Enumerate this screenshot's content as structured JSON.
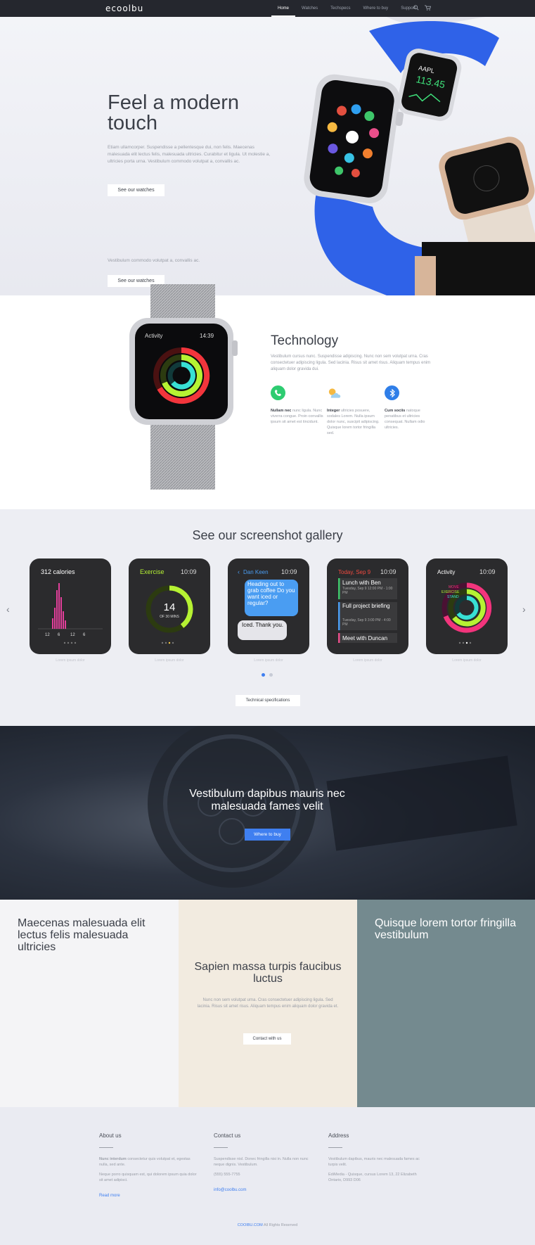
{
  "nav": {
    "logo": "ecoolbu",
    "links": [
      "Home",
      "Watches",
      "Techspecs",
      "Where to buy",
      "Support"
    ],
    "active": "Home",
    "icons": [
      "search-icon",
      "cart-icon"
    ]
  },
  "hero": {
    "title": "Feel a modern touch",
    "body": "Etiam ullamcorper. Suspendisse a pellentesque dui, non felis. Maecenas malesuada elit lectus felis, malesuada ultricies. Curabitur et ligula. Ut molestie a, ultricies porta urna. Vestibulum commodo volutpat a, convallis ac.",
    "button": "See our watches",
    "body2": "Vestibulum commodo volutpat a, convallis ac.",
    "button2": "See our watches",
    "watch_time": "10:09",
    "watch_stock": "AAPL",
    "watch_price": "113.45"
  },
  "tech": {
    "title": "Technology",
    "body": "Vestibulum cursus nunc. Suspendisse adipiscing. Nunc non sem volutpat urna. Cras consectetuer adipiscing ligula. Sed lacinia. Risus sit amet risus. Aliquam tempus enim aliquam dolor gravida dui.",
    "watch_label": "Activity",
    "watch_time": "14:39",
    "features": [
      {
        "bold": "Nullam nec",
        "text": "nunc ligula. Nunc viverra congue. Proin convallis ipsum sit amet est tincidunt.",
        "icon": "phone-icon",
        "color": "#2ecc71"
      },
      {
        "bold": "Integer",
        "text": "ultricies posuere, sodales Lorem. Nulla ipsum dolor nunc, suscipit adipiscing. Quisque lorem tortor fringilla sed.",
        "icon": "weather-icon",
        "color": "#f5b942"
      },
      {
        "bold": "Cum sociis",
        "text": "natoque penatibus et ultricies consequat. Nullam odio ultricies.",
        "icon": "bluetooth-icon",
        "color": "#2f7ee8"
      }
    ]
  },
  "gallery": {
    "title": "See our screenshot gallery",
    "screens": [
      {
        "name": "calories",
        "title": "312 calories",
        "labels": [
          "12",
          "6",
          "12",
          "6"
        ],
        "caption": "Lorem ipsum dolor"
      },
      {
        "name": "exercise",
        "title": "Exercise",
        "time": "10:09",
        "value": "14",
        "unit": "OF 30 MINS",
        "caption": "Lorem ipsum dolor"
      },
      {
        "name": "messages",
        "title": "Dan Keen",
        "time": "10:09",
        "msg1": "Heading out to grab coffee Do you want iced or regular?",
        "msg2": "Iced. Thank you.",
        "caption": "Lorem ipsum dolor"
      },
      {
        "name": "calendar",
        "title": "Today, Sep 9",
        "time": "10:09",
        "ev1": "Lunch with Ben",
        "ev1sub": "Tuesday, Sep 9 12:00 PM - 1:00 PM",
        "ev2": "Full project briefing",
        "ev2sub": "Tuesday, Sep 9 3:00 PM - 4:00 PM",
        "ev3": "Meet with Duncan",
        "caption": "Lorem ipsum dolor"
      },
      {
        "name": "activity",
        "title": "Activity",
        "time": "10:09",
        "move": "MOVE",
        "exercise": "EXERCISE",
        "stand": "STAND",
        "caption": "Lorem ipsum dolor"
      }
    ],
    "button": "Technical specifications"
  },
  "cta": {
    "title": "Vestibulum dapibus mauris nec malesuada fames velit",
    "button": "Where to buy"
  },
  "columns": {
    "col1_title": "Maecenas malesuada elit lectus felis malesuada ultricies",
    "col2_title": "Sapien massa turpis faucibus luctus",
    "col2_body": "Nunc non sem volutpat urna. Cras consectetuer adipiscing ligula. Sed lacinia. Risus sit amet risus. Aliquam tempus enim aliquam dolor gravida et.",
    "col2_button": "Contact with us",
    "col3_title": "Quisque lorem tortor fringilla vestibulum"
  },
  "footer": {
    "about_title": "About us",
    "about_p1_bold": "Nunc interdum",
    "about_p1": "consectetur quis volutpat et, egestas nulla, sed ante.",
    "about_p2": "Neque porro quisquam est, qui dolorem ipsum quia dolor sit amet adipisci.",
    "about_link": "Read more",
    "contact_title": "Contact us",
    "contact_p1": "Suspendisse nisl. Donec fringilla nisi in. Nulla non nunc neque dignis. Vestibulum.",
    "contact_phone": "(555) 555-7755",
    "contact_email": "info@coolbu.com",
    "address_title": "Address",
    "address_p1": "Vestibulum dapibus, mauris nec malesuada fames ac turpis velit.",
    "address_p2": "EdiMedia - Quisque, cursus Lorem 13, 22 Elizabeth Ontario, D993 D06",
    "copyright_brand": "COOIBU.COM",
    "copyright": "All Rights Reserved"
  }
}
